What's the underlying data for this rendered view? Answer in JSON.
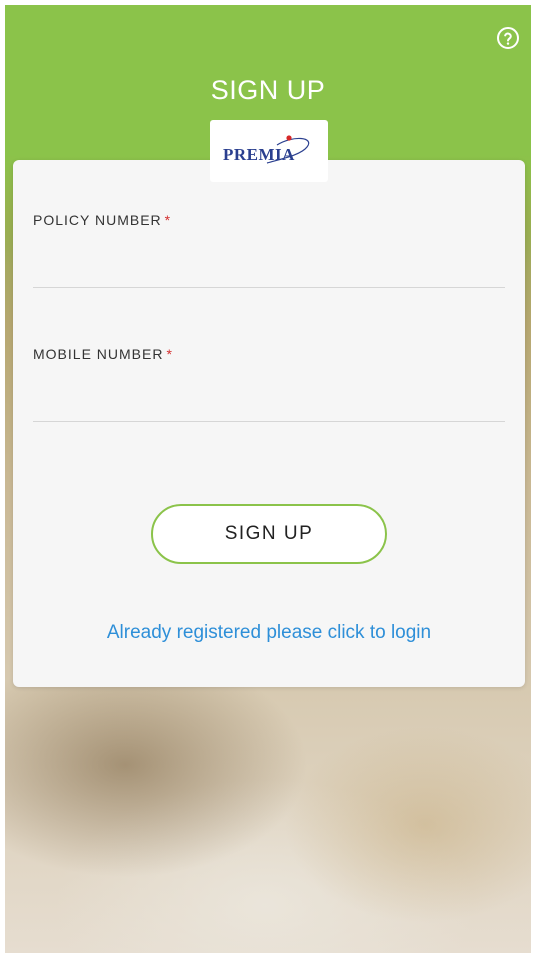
{
  "header": {
    "title": "SIGN UP",
    "help_icon": "help-circle-icon",
    "logo_text": "PREMIA",
    "background_color": "#8bc34a"
  },
  "form": {
    "policy_number": {
      "label": "POLICY NUMBER",
      "required_marker": "*",
      "value": ""
    },
    "mobile_number": {
      "label": "MOBILE NUMBER",
      "required_marker": "*",
      "value": ""
    },
    "submit_label": "SIGN UP",
    "login_link": "Already registered please click to login"
  },
  "colors": {
    "accent": "#8bc34a",
    "link": "#2e8fd8",
    "required": "#d32f2f",
    "card": "#f6f6f6"
  }
}
